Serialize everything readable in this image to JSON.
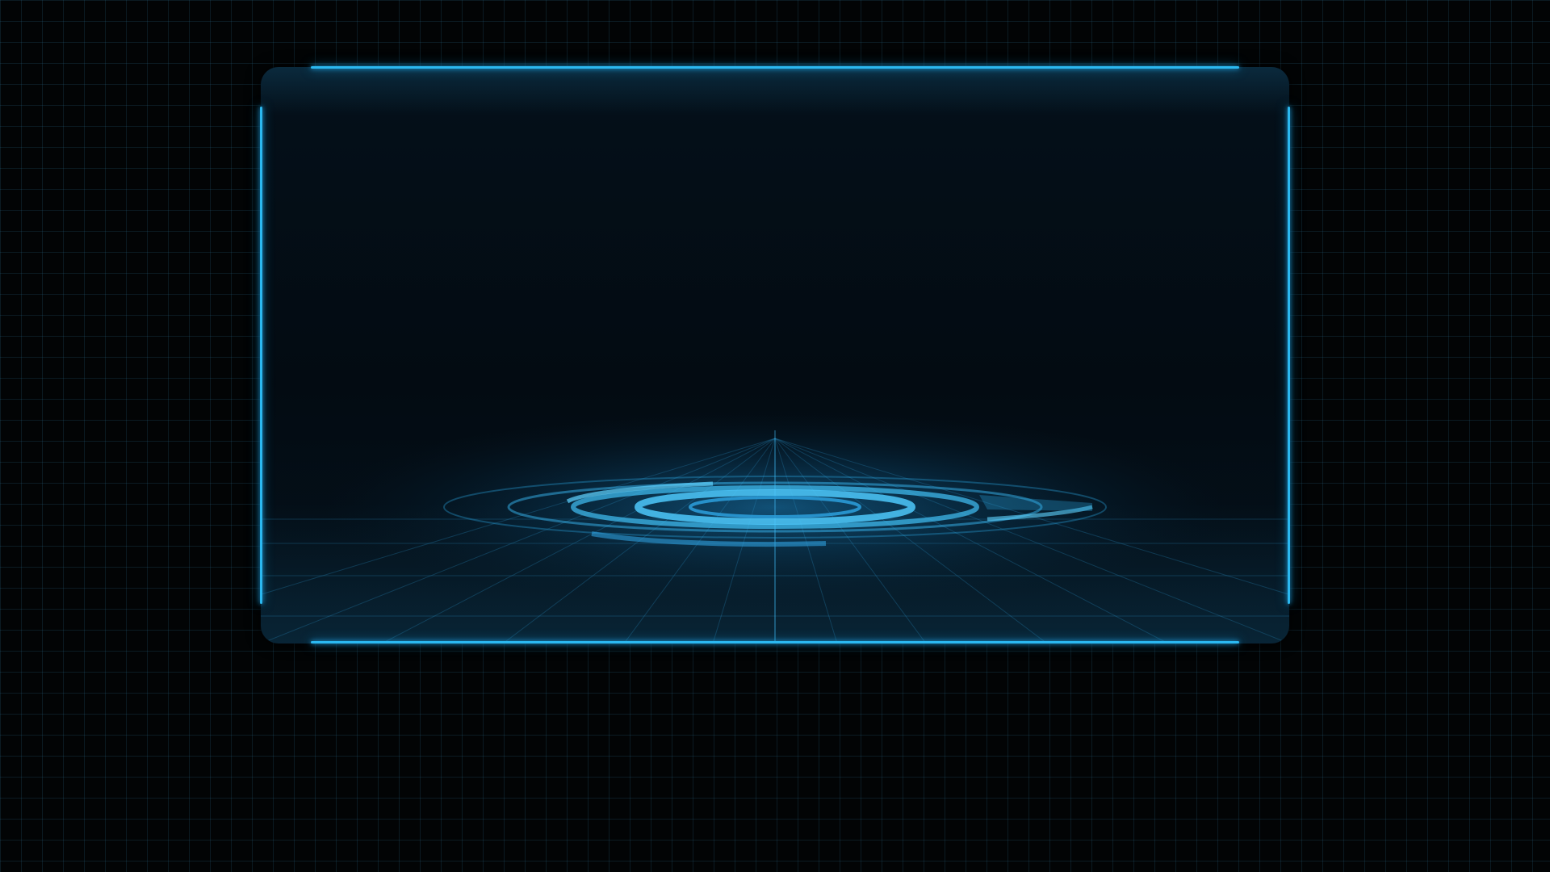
{
  "theme": {
    "background": "#020405",
    "panel_fill": "#030b12",
    "accent": "#2bb8f0",
    "grid_line": "#286e8c"
  },
  "icons": {
    "hud_ring": "hud-ring-icon"
  }
}
